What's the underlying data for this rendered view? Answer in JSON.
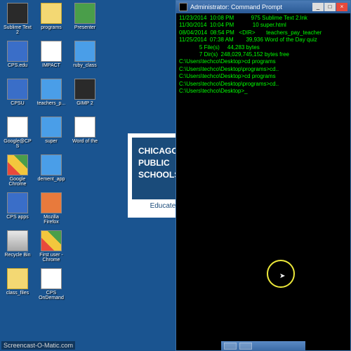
{
  "desktop_icons": [
    {
      "label": "Sublime Text 2",
      "cls": "dark"
    },
    {
      "label": "CPS.edu",
      "cls": "blue"
    },
    {
      "label": "CPSU",
      "cls": "blue"
    },
    {
      "label": "Google@CPS",
      "cls": "doc"
    },
    {
      "label": "Google Chrome",
      "cls": "chrome"
    },
    {
      "label": "CPS apps",
      "cls": "blue"
    },
    {
      "label": "Recycle Bin",
      "cls": "recycle"
    },
    {
      "label": "class_files",
      "cls": "folder"
    },
    {
      "label": "programs",
      "cls": "folder"
    },
    {
      "label": "IMPACT",
      "cls": "doc"
    },
    {
      "label": "teachers_p...",
      "cls": "ie"
    },
    {
      "label": "super",
      "cls": "ie"
    },
    {
      "label": "dement_app",
      "cls": "ie"
    },
    {
      "label": "Mozilla Firefox",
      "cls": "firefox"
    },
    {
      "label": "First user - Chrome",
      "cls": "chrome"
    },
    {
      "label": "CPS OnDemand",
      "cls": "doc"
    },
    {
      "label": "Presenter",
      "cls": "green"
    },
    {
      "label": "ruby_class",
      "cls": "ie"
    },
    {
      "label": "GIMP 2",
      "cls": "dark"
    },
    {
      "label": "Word of the",
      "cls": "doc"
    }
  ],
  "logo": {
    "line1": "CHICAGO",
    "line2": "PUBLIC",
    "line3": "SCHOOLS",
    "tagline": "Educate • Inspi"
  },
  "terminal": {
    "title": "Administrator: Command Prompt",
    "lines": [
      "11/23/2014  10:08 PM           975 Sublime Text 2.lnk",
      "11/30/2014  10:04 PM            10 super.html",
      "08/04/2014  08:54 PM   <DIR>       teachers_pay_teacher",
      "11/25/2014  07:38 AM        39,936 Word of the Day quiz",
      "             5 File(s)     44,283 bytes",
      "             7 Dir(s)  248,029,745,152 bytes free",
      "",
      "C:\\Users\\techco\\Desktop>cd programs",
      "",
      "C:\\Users\\techco\\Desktop\\programs>cd..",
      "",
      "C:\\Users\\techco\\Desktop>cd programs",
      "",
      "C:\\Users\\techco\\Desktop\\programs>cd..",
      "",
      "C:\\Users\\techco\\Desktop>_"
    ]
  },
  "watermark": "Screencast-O-Matic.com"
}
